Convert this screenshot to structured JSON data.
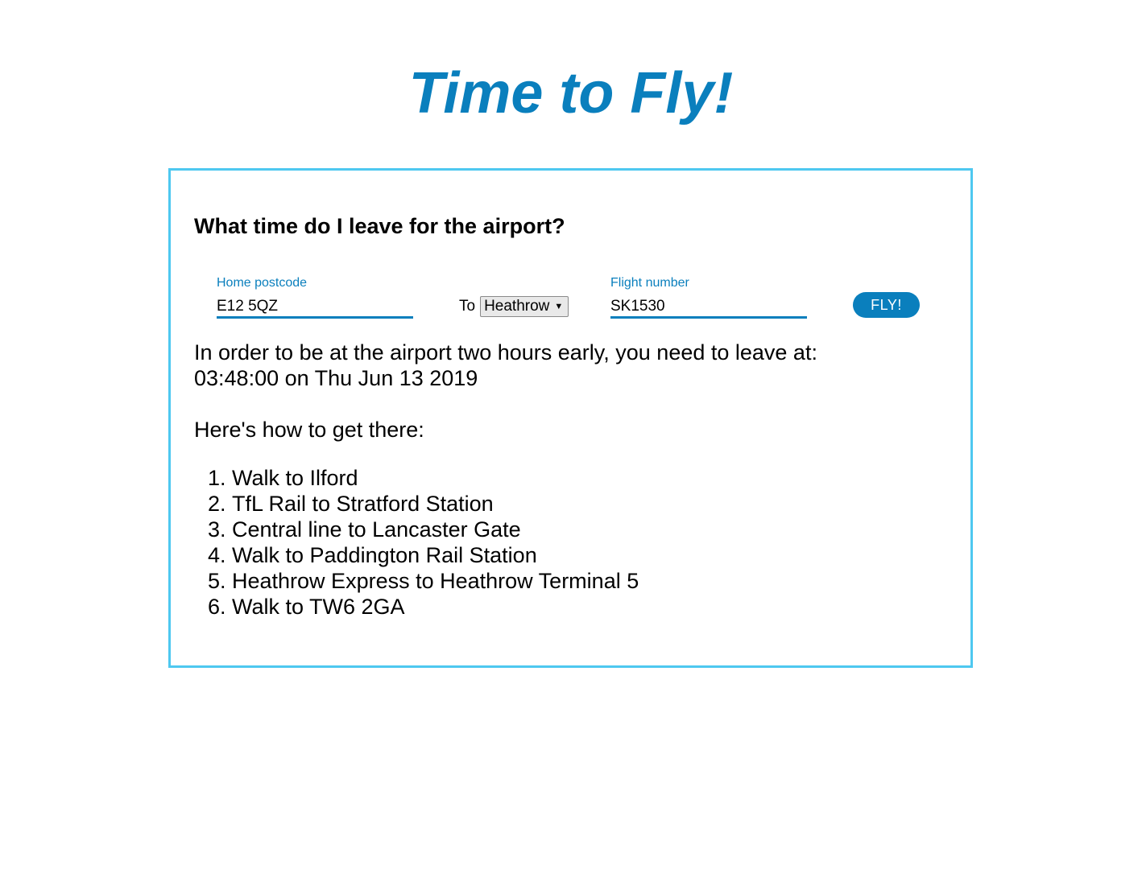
{
  "header": {
    "title": "Time to Fly!"
  },
  "form": {
    "question": "What time do I leave for the airport?",
    "postcode_label": "Home postcode",
    "postcode_value": "E12 5QZ",
    "to_label": "To",
    "airport_selected": "Heathrow",
    "flight_label": "Flight number",
    "flight_value": "SK1530",
    "submit_label": "FLY!"
  },
  "result": {
    "line1": "In order to be at the airport two hours early, you need to leave at:",
    "line2": "03:48:00 on Thu Jun 13 2019"
  },
  "directions": {
    "heading": "Here's how to get there:",
    "steps": [
      "Walk to Ilford",
      "TfL Rail to Stratford Station",
      "Central line to Lancaster Gate",
      "Walk to Paddington Rail Station",
      "Heathrow Express to Heathrow Terminal 5",
      "Walk to TW6 2GA"
    ]
  },
  "colors": {
    "accent": "#0a7fbd",
    "card_border": "#4ec8f0"
  }
}
